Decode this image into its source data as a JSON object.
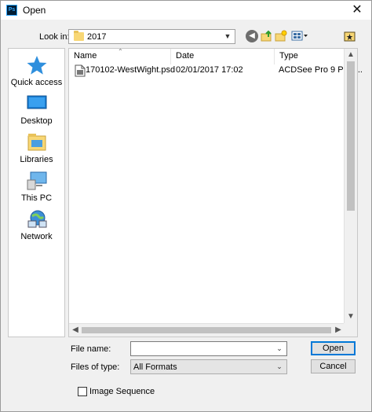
{
  "window": {
    "title": "Open",
    "app_icon_text": "Ps",
    "close_glyph": "✕"
  },
  "toolbar": {
    "look_in_label": "Look in:",
    "look_in_value": "2017",
    "icons": [
      "back-icon",
      "up-folder-icon",
      "new-folder-icon",
      "view-menu-icon",
      "desktop-shortcut-icon"
    ]
  },
  "sidebar": {
    "items": [
      {
        "label": "Quick access",
        "icon": "star-icon"
      },
      {
        "label": "Desktop",
        "icon": "desktop-icon"
      },
      {
        "label": "Libraries",
        "icon": "libraries-icon"
      },
      {
        "label": "This PC",
        "icon": "computer-icon"
      },
      {
        "label": "Network",
        "icon": "network-icon"
      }
    ]
  },
  "filelist": {
    "columns": [
      "Name",
      "Date",
      "Type"
    ],
    "rows": [
      {
        "name": "170102-WestWight.psd",
        "date": "02/01/2017 17:02",
        "type": "ACDSee Pro 9 PSD..."
      }
    ]
  },
  "form": {
    "file_name_label": "File name:",
    "file_name_value": "",
    "files_of_type_label": "Files of type:",
    "files_of_type_value": "All Formats",
    "open_label": "Open",
    "cancel_label": "Cancel",
    "image_sequence_label": "Image Sequence",
    "image_sequence_checked": false
  },
  "colors": {
    "accent": "#0078d7",
    "folder": "#f8d775",
    "star": "#2f8fdd"
  }
}
